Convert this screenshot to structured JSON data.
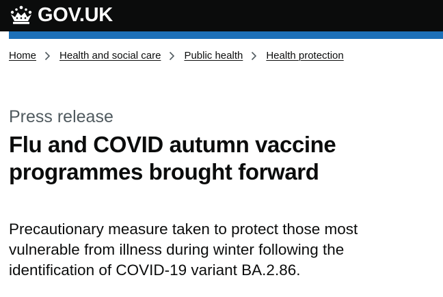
{
  "header": {
    "logo_text": "GOV.UK",
    "logo_icon": "crown-icon"
  },
  "breadcrumbs": [
    {
      "label": "Home"
    },
    {
      "label": "Health and social care"
    },
    {
      "label": "Public health"
    },
    {
      "label": "Health protection"
    }
  ],
  "content": {
    "caption": "Press release",
    "title": "Flu and COVID autumn vaccine programmes brought forward",
    "lead": "Precautionary measure taken to protect those most vulnerable from illness during winter following the identification of COVID-19 variant BA.2.86."
  },
  "colors": {
    "header_bg": "#0b0c0c",
    "brand_blue": "#1d70b8",
    "caption_grey": "#505a5f",
    "text": "#0b0c0c"
  }
}
